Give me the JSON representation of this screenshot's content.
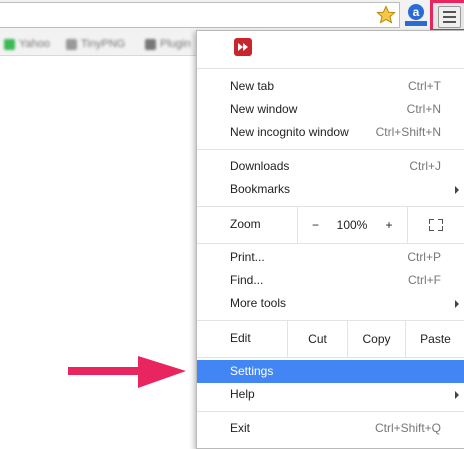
{
  "toolbar": {
    "extension_badge": "a",
    "bookmarks": [
      "Yahoo",
      "TinyPNG",
      "Plugin"
    ]
  },
  "menu": {
    "items": {
      "new_tab": {
        "label": "New tab",
        "shortcut": "Ctrl+T"
      },
      "new_window": {
        "label": "New window",
        "shortcut": "Ctrl+N"
      },
      "new_incognito": {
        "label": "New incognito window",
        "shortcut": "Ctrl+Shift+N"
      },
      "downloads": {
        "label": "Downloads",
        "shortcut": "Ctrl+J"
      },
      "bookmarks": {
        "label": "Bookmarks"
      },
      "print": {
        "label": "Print...",
        "shortcut": "Ctrl+P"
      },
      "find": {
        "label": "Find...",
        "shortcut": "Ctrl+F"
      },
      "more_tools": {
        "label": "More tools"
      },
      "settings": {
        "label": "Settings"
      },
      "help": {
        "label": "Help"
      },
      "exit": {
        "label": "Exit",
        "shortcut": "Ctrl+Shift+Q"
      }
    },
    "zoom": {
      "label": "Zoom",
      "minus": "−",
      "value": "100%",
      "plus": "+"
    },
    "edit": {
      "label": "Edit",
      "cut": "Cut",
      "copy": "Copy",
      "paste": "Paste"
    }
  },
  "colors": {
    "highlight": "#4285f4",
    "annotation": "#e8255f",
    "adblock": "#c8252c"
  }
}
